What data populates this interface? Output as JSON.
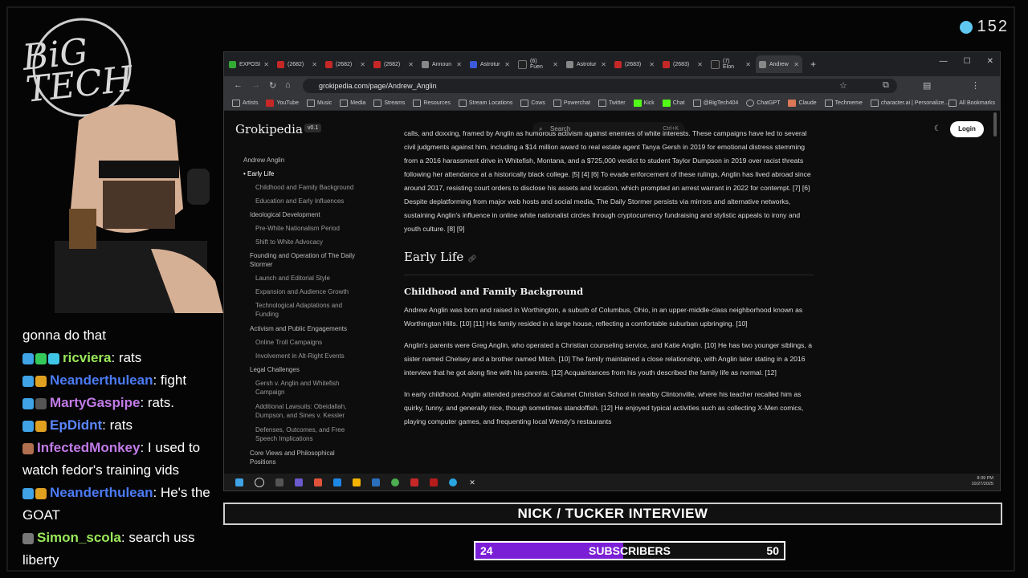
{
  "overlay": {
    "viewer_count": "152",
    "logo_text": "BIG TECH",
    "banner_title": "NICK / TUCKER INTERVIEW",
    "subs": {
      "current": "24",
      "label": "SUBSCRIBERS",
      "goal": "50",
      "progress": 0.48
    }
  },
  "chat": [
    {
      "user": "",
      "text": "gonna do that",
      "color": "#ffffff"
    },
    {
      "user": "ricviera",
      "text": ": rats",
      "color": "#9ae85a"
    },
    {
      "user": "Neanderthulean",
      "text": ": fight",
      "color": "#4b7bf5"
    },
    {
      "user": "MartyGaspipe",
      "text": ": rats.",
      "color": "#c27be8"
    },
    {
      "user": "EpDidnt",
      "text": ": rats",
      "color": "#5b86ff"
    },
    {
      "user": "InfectedMonkey",
      "text": ": I used to watch fedor's training vids",
      "color": "#c27be8"
    },
    {
      "user": "Neanderthulean",
      "text": ": He's the GOAT",
      "color": "#4b7bf5"
    },
    {
      "user": "Simon_scola",
      "text": ": search uss liberty",
      "color": "#9ae85a"
    }
  ],
  "browser": {
    "tabs": [
      {
        "label": "EXPOSI",
        "fav": "#33aa33"
      },
      {
        "label": "(2682)",
        "fav": "#c62828"
      },
      {
        "label": "(2682)",
        "fav": "#c62828"
      },
      {
        "label": "(2682)",
        "fav": "#c62828"
      },
      {
        "label": "Announ",
        "fav": "#888888"
      },
      {
        "label": "Astrotur",
        "fav": "#3b5bdb"
      },
      {
        "label": "(6) Fuen",
        "fav": "#222222"
      },
      {
        "label": "Astrotur",
        "fav": "#888888"
      },
      {
        "label": "(2683)",
        "fav": "#c62828"
      },
      {
        "label": "(2683)",
        "fav": "#c62828"
      },
      {
        "label": "(7) Elon",
        "fav": "#222222"
      },
      {
        "label": "Andrew",
        "fav": "#888888"
      }
    ],
    "url": "grokipedia.com/page/Andrew_Anglin",
    "bookmarks": [
      "Artists",
      "YouTube",
      "Music",
      "Media",
      "Streams",
      "Resources",
      "Stream Locations",
      "Cows",
      "Powerchat",
      "Twitter",
      "Kick",
      "Chat",
      "@BigTech404",
      "ChatGPT",
      "Claude",
      "Techmeme",
      "character.ai | Personalize..."
    ],
    "all_bookmarks": "All Bookmarks"
  },
  "site": {
    "name": "Grokipedia",
    "version": "v0.1",
    "search_placeholder": "Search",
    "search_kbd": "Ctrl+K",
    "login": "Login"
  },
  "toc": [
    {
      "label": "Andrew Anglin",
      "level": 0
    },
    {
      "label": "Early Life",
      "level": 1,
      "active": true
    },
    {
      "label": "Childhood and Family Background",
      "level": 2
    },
    {
      "label": "Education and Early Influences",
      "level": 2
    },
    {
      "label": "Ideological Development",
      "level": 1
    },
    {
      "label": "Pre-White Nationalism Period",
      "level": 2
    },
    {
      "label": "Shift to White Advocacy",
      "level": 2
    },
    {
      "label": "Founding and Operation of The Daily Stormer",
      "level": 1
    },
    {
      "label": "Launch and Editorial Style",
      "level": 2
    },
    {
      "label": "Expansion and Audience Growth",
      "level": 2
    },
    {
      "label": "Technological Adaptations and Funding",
      "level": 2
    },
    {
      "label": "Activism and Public Engagements",
      "level": 1
    },
    {
      "label": "Online Troll Campaigns",
      "level": 2
    },
    {
      "label": "Involvement in Alt-Right Events",
      "level": 2
    },
    {
      "label": "Legal Challenges",
      "level": 1
    },
    {
      "label": "Gersh v. Anglin and Whitefish Campaign",
      "level": 2
    },
    {
      "label": "Additional Lawsuits: Obeidallah, Dumpson, and Sines v. Kessler",
      "level": 2
    },
    {
      "label": "Defenses, Outcomes, and Free Speech Implications",
      "level": 2
    },
    {
      "label": "Core Views and Philosophical Positions",
      "level": 1
    }
  ],
  "article": {
    "intro_p": "calls, and doxxing, framed by Anglin as humorous activism against enemies of white interests. These campaigns have led to several civil judgments against him, including a $14 million award to real estate agent Tanya Gersh in 2019 for emotional distress stemming from a 2016 harassment drive in Whitefish, Montana, and a $725,000 verdict to student Taylor Dumpson in 2019 over racist threats following her attendance at a historically black college. [5] [4] [6] To evade enforcement of these rulings, Anglin has lived abroad since around 2017, resisting court orders to disclose his assets and location, which prompted an arrest warrant in 2022 for contempt. [7] [6] Despite deplatforming from major web hosts and social media, The Daily Stormer persists via mirrors and alternative networks, sustaining Anglin's influence in online white nationalist circles through cryptocurrency fundraising and stylistic appeals to irony and youth culture. [8] [9]",
    "h2": "Early Life",
    "h3": "Childhood and Family Background",
    "p1": "Andrew Anglin was born and raised in Worthington, a suburb of Columbus, Ohio, in an upper-middle-class neighborhood known as Worthington Hills. [10] [11] His family resided in a large house, reflecting a comfortable suburban upbringing. [10]",
    "p2": "Anglin's parents were Greg Anglin, who operated a Christian counseling service, and Katie Anglin. [10] He has two younger siblings, a sister named Chelsey and a brother named Mitch. [10] The family maintained a close relationship, with Anglin later stating in a 2016 interview that he got along fine with his parents. [12] Acquaintances from his youth described the family life as normal. [12]",
    "p3": "In early childhood, Anglin attended preschool at Calumet Christian School in nearby Clintonville, where his teacher recalled him as quirky, funny, and generally nice, though sometimes standoffish. [12] He enjoyed typical activities such as collecting X-Men comics, playing computer games, and frequenting local Wendy's restaurants"
  },
  "taskbar": {
    "time": "8:39 PM",
    "date": "10/27/2025"
  }
}
